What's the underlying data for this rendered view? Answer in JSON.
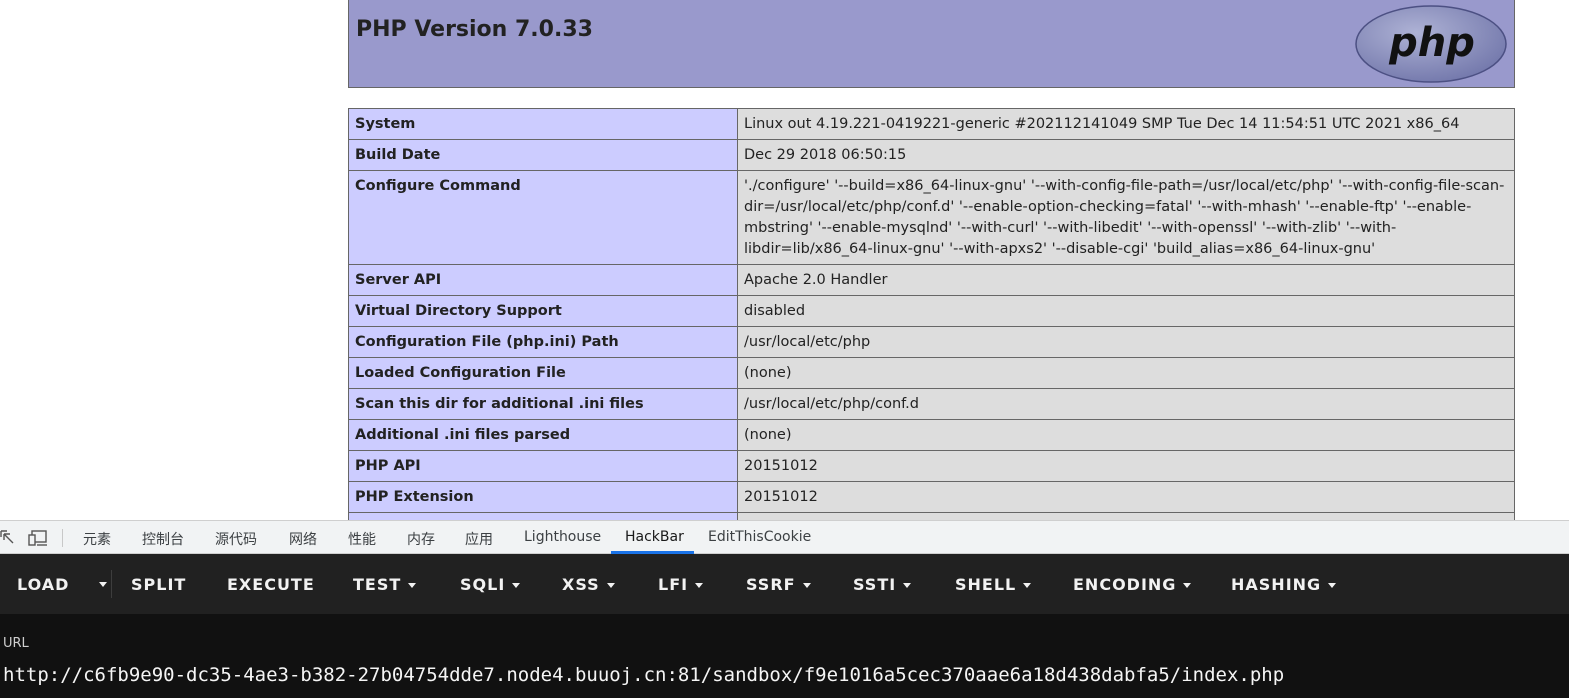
{
  "phpinfo": {
    "title": "PHP Version 7.0.33",
    "logo_text": "php",
    "rows": [
      {
        "label": "System",
        "value": "Linux out 4.19.221-0419221-generic #202112141049 SMP Tue Dec 14 11:54:51 UTC 2021 x86_64"
      },
      {
        "label": "Build Date",
        "value": "Dec 29 2018 06:50:15"
      },
      {
        "label": "Configure Command",
        "value": "'./configure' '--build=x86_64-linux-gnu' '--with-config-file-path=/usr/local/etc/php' '--with-config-file-scan-dir=/usr/local/etc/php/conf.d' '--enable-option-checking=fatal' '--with-mhash' '--enable-ftp' '--enable-mbstring' '--enable-mysqlnd' '--with-curl' '--with-libedit' '--with-openssl' '--with-zlib' '--with-libdir=lib/x86_64-linux-gnu' '--with-apxs2' '--disable-cgi' 'build_alias=x86_64-linux-gnu'"
      },
      {
        "label": "Server API",
        "value": "Apache 2.0 Handler"
      },
      {
        "label": "Virtual Directory Support",
        "value": "disabled"
      },
      {
        "label": "Configuration File (php.ini) Path",
        "value": "/usr/local/etc/php"
      },
      {
        "label": "Loaded Configuration File",
        "value": "(none)"
      },
      {
        "label": "Scan this dir for additional .ini files",
        "value": "/usr/local/etc/php/conf.d"
      },
      {
        "label": "Additional .ini files parsed",
        "value": "(none)"
      },
      {
        "label": "PHP API",
        "value": "20151012"
      },
      {
        "label": "PHP Extension",
        "value": "20151012"
      },
      {
        "label": "",
        "value": ""
      }
    ]
  },
  "devtools": {
    "tabs": [
      "元素",
      "控制台",
      "源代码",
      "网络",
      "性能",
      "内存",
      "应用",
      "Lighthouse",
      "HackBar",
      "EditThisCookie"
    ],
    "active_tab": "HackBar"
  },
  "hackbar": {
    "buttons": [
      "LOAD",
      "SPLIT",
      "EXECUTE",
      "TEST",
      "SQLI",
      "XSS",
      "LFI",
      "SSRF",
      "SSTI",
      "SHELL",
      "ENCODING",
      "HASHING"
    ],
    "url_label": "URL",
    "url_value": "http://c6fb9e90-dc35-4ae3-b382-27b04754dde7.node4.buuoj.cn:81/sandbox/f9e1016a5cec370aae6a18d438dabfa5/index.php"
  },
  "colors": {
    "header_bg": "#9999cc",
    "label_cell_bg": "#ccccff",
    "value_cell_bg": "#dddddd",
    "hackbar_toolbar_bg": "#212121",
    "hackbar_body_bg": "#111111",
    "active_tab_underline": "#1a73e8"
  }
}
